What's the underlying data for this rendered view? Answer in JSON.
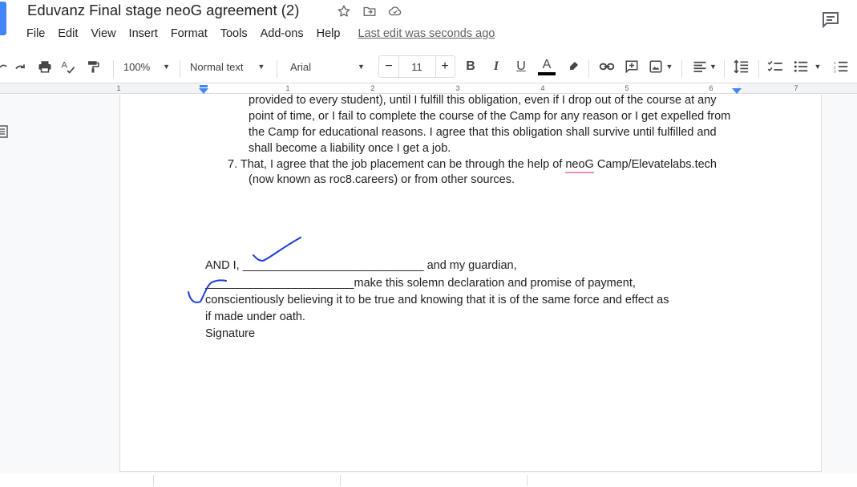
{
  "header": {
    "title": "Eduvanz Final stage neoG agreement (2)",
    "menu": [
      "File",
      "Edit",
      "View",
      "Insert",
      "Format",
      "Tools",
      "Add-ons",
      "Help"
    ],
    "last_edit": "Last edit was seconds ago"
  },
  "toolbar": {
    "zoom": "100%",
    "style": "Normal text",
    "font": "Arial",
    "font_size": "11",
    "minus": "−",
    "plus": "+",
    "bold": "B",
    "italic": "I",
    "underline": "U",
    "text_color": "A"
  },
  "ruler": {
    "numbers": [
      "1",
      "1",
      "2",
      "3",
      "4",
      "5",
      "6",
      "7"
    ]
  },
  "document": {
    "lines": [
      "provided to every student), until I fulfill this obligation, even if I drop out of the course at any",
      "point of time, or I fail to complete the course of the Camp for any reason or I get expelled from",
      "the Camp for educational reasons. I agree that this obligation shall survive until fulfilled and",
      "shall become a liability once I get a job."
    ],
    "item7": {
      "number": "7.",
      "before": "That, I agree that the job placement can be through the help of ",
      "flagged": "neoG",
      "after": " Camp/Elevatelabs.tech",
      "line2": "(now known as roc8.careers) or from other sources."
    },
    "declaration": {
      "line1_start": "AND I, ",
      "line1_blank": "____________________________",
      "line1_end": " and my guardian,",
      "line2_blank": "_______________________",
      "line2_end": "make this solemn declaration and promise of payment,",
      "line3": "conscientiously believing it to be true and knowing that it is of the same force and effect as",
      "line4": "if made under oath.",
      "signature": "Signature"
    }
  },
  "colors": {
    "accent": "#4285f4",
    "checkmark": "#1a3fd6",
    "spell_flag": "#f08fb4"
  }
}
